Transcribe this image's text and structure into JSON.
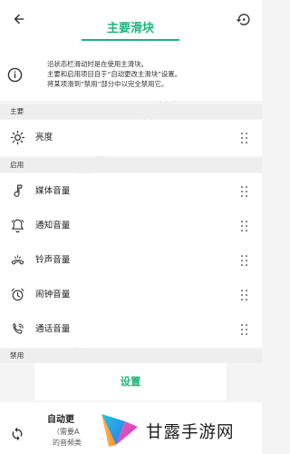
{
  "header": {
    "title": "主要滑块",
    "back_icon": "arrow-left-icon",
    "reset_icon": "restore-icon",
    "accent_color": "#1db47a"
  },
  "info": {
    "icon": "info-icon",
    "lines": [
      "沿状态栏滑动时是在使用主滑块。",
      "主要和启用项目自于“自动更改主滑块”设置。",
      "将某项滑到“禁用”部分中以完全禁用它。"
    ]
  },
  "sections": {
    "primary": {
      "header": "主要",
      "items": [
        {
          "label": "亮度",
          "icon": "brightness-icon"
        }
      ]
    },
    "enabled": {
      "header": "启用",
      "items": [
        {
          "label": "媒体音量",
          "icon": "music-note-icon"
        },
        {
          "label": "通知音量",
          "icon": "bell-icon"
        },
        {
          "label": "铃声音量",
          "icon": "ringtone-icon"
        },
        {
          "label": "闹钟音量",
          "icon": "alarm-icon"
        },
        {
          "label": "通话音量",
          "icon": "phone-icon"
        }
      ]
    },
    "disabled": {
      "header": "禁用"
    }
  },
  "settings_button": {
    "label": "设置"
  },
  "disabled_item": {
    "title": "自动更",
    "subtitle_lines": [
      "（需要A",
      "的音频类"
    ],
    "icon": "sync-icon"
  },
  "logo": {
    "text": "甘露手游网"
  },
  "watermark": {
    "text": "www.ganlu.net"
  }
}
